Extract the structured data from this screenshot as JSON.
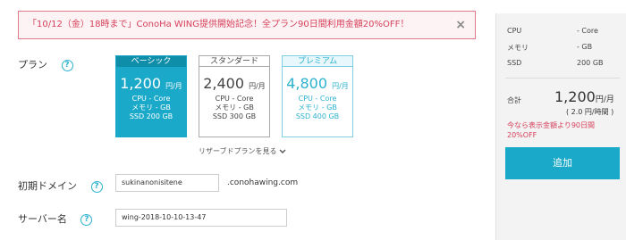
{
  "banner": {
    "text": "「10/12（金）18時まで」ConoHa WING提供開始記念！全プラン90日間利用金額20%OFF！",
    "close": "×"
  },
  "plan_section": {
    "label": "プラン",
    "help": "?",
    "plans": [
      {
        "title": "ベーシック",
        "price": "1,200",
        "unit": "円/月",
        "cpu": "CPU  - Core",
        "memory": "メモリ  - GB",
        "ssd": "SSD  200 GB"
      },
      {
        "title": "スタンダード",
        "price": "2,400",
        "unit": "円/月",
        "cpu": "CPU  - Core",
        "memory": "メモリ  - GB",
        "ssd": "SSD  300 GB"
      },
      {
        "title": "プレミアム",
        "price": "4,800",
        "unit": "円/月",
        "cpu": "CPU  - Core",
        "memory": "メモリ  - GB",
        "ssd": "SSD  400 GB"
      }
    ],
    "reserved_link": "リザーブドプランを見る"
  },
  "domain": {
    "label": "初期ドメイン",
    "help": "?",
    "value": "sukinanonisitene",
    "suffix": ".conohawing.com"
  },
  "server_name": {
    "label": "サーバー名",
    "help": "?",
    "value": "wing-2018-10-10-13-47"
  },
  "summary": {
    "cpu_label": "CPU",
    "cpu_value": "- Core",
    "memory_label": "メモリ",
    "memory_value": "- GB",
    "ssd_label": "SSD",
    "ssd_value": "200 GB",
    "total_label": "合計",
    "total_price": "1,200",
    "total_unit": "円/月",
    "total_hourly": "( 2.0 円/時間 )",
    "discount_note": "今なら表示金額より90日間20%OFF",
    "add_button": "追加"
  },
  "colors": {
    "accent": "#1aa9c9",
    "alert": "#d6405a"
  }
}
